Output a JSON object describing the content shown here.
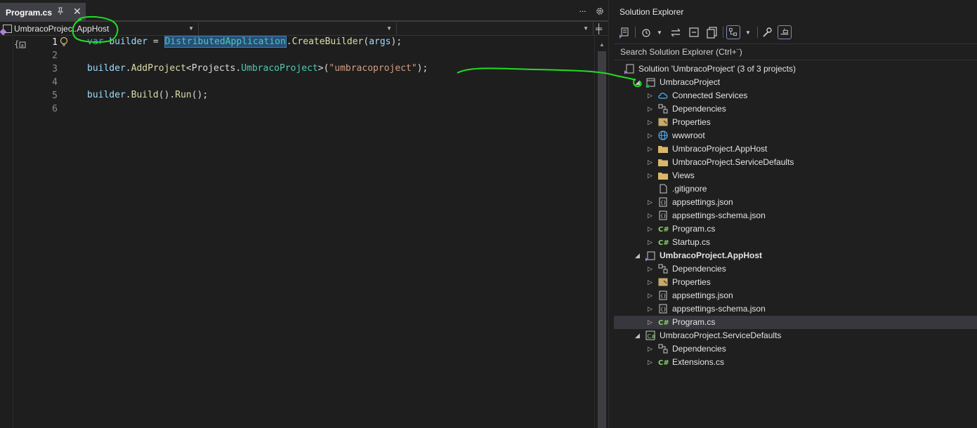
{
  "editor": {
    "tab": {
      "label": "Program.cs",
      "pin_icon": "pin-icon",
      "close_icon": "close-icon"
    },
    "tab_overflow": "···",
    "nav": {
      "project": "UmbracoProject.AppHost",
      "type": "",
      "member": ""
    },
    "lines": [
      "1",
      "2",
      "3",
      "4",
      "5",
      "6"
    ],
    "code": {
      "l1": {
        "kw": "var",
        "id": "builder",
        "eq": " = ",
        "cls": "DistributedApplication",
        "dot": ".",
        "method": "CreateBuilder",
        "open": "(",
        "arg": "args",
        "close": ");"
      },
      "l3": {
        "id": "builder",
        "dot": ".",
        "method": "AddProject",
        "lt": "<",
        "ns": "Projects",
        "dot2": ".",
        "type": "UmbracoProject",
        "gt": ">(",
        "str": "\"umbracoproject\"",
        "close": ");"
      },
      "l5": {
        "id": "builder",
        "dot": ".",
        "m1": "Build",
        "p1": "().",
        "m2": "Run",
        "p2": "();"
      }
    }
  },
  "solution_explorer": {
    "title": "Solution Explorer",
    "search_placeholder": "Search Solution Explorer (Ctrl+¨)",
    "tree": [
      {
        "label": "Solution 'UmbracoProject' (3 of 3 projects)",
        "icon": "solution-icon",
        "expander": ""
      },
      {
        "label": "UmbracoProject",
        "icon": "web-project-icon",
        "expander": "expanded"
      },
      {
        "label": "Connected Services",
        "icon": "cloud-icon",
        "expander": "collapsed"
      },
      {
        "label": "Dependencies",
        "icon": "dependencies-icon",
        "expander": "collapsed"
      },
      {
        "label": "Properties",
        "icon": "properties-icon",
        "expander": "collapsed"
      },
      {
        "label": "wwwroot",
        "icon": "globe-icon",
        "expander": "collapsed"
      },
      {
        "label": "UmbracoProject.AppHost",
        "icon": "folder-icon",
        "expander": "collapsed"
      },
      {
        "label": "UmbracoProject.ServiceDefaults",
        "icon": "folder-icon",
        "expander": "collapsed"
      },
      {
        "label": "Views",
        "icon": "folder-icon",
        "expander": "collapsed"
      },
      {
        "label": ".gitignore",
        "icon": "file-icon",
        "expander": ""
      },
      {
        "label": "appsettings.json",
        "icon": "json-icon",
        "expander": "collapsed"
      },
      {
        "label": "appsettings-schema.json",
        "icon": "json-icon",
        "expander": "collapsed"
      },
      {
        "label": "Program.cs",
        "icon": "csharp-file-icon",
        "expander": "collapsed"
      },
      {
        "label": "Startup.cs",
        "icon": "csharp-file-icon",
        "expander": "collapsed"
      },
      {
        "label": "UmbracoProject.AppHost",
        "icon": "apphost-project-icon",
        "expander": "expanded",
        "bold": true
      },
      {
        "label": "Dependencies",
        "icon": "dependencies-icon",
        "expander": "collapsed"
      },
      {
        "label": "Properties",
        "icon": "properties-icon",
        "expander": "collapsed"
      },
      {
        "label": "appsettings.json",
        "icon": "json-icon",
        "expander": "collapsed"
      },
      {
        "label": "appsettings-schema.json",
        "icon": "json-icon",
        "expander": "collapsed"
      },
      {
        "label": "Program.cs",
        "icon": "csharp-file-icon",
        "expander": "collapsed",
        "selected": true
      },
      {
        "label": "UmbracoProject.ServiceDefaults",
        "icon": "csharp-project-icon",
        "expander": "expanded"
      },
      {
        "label": "Dependencies",
        "icon": "dependencies-icon",
        "expander": "collapsed"
      },
      {
        "label": "Extensions.cs",
        "icon": "csharp-file-icon",
        "expander": "collapsed"
      }
    ]
  },
  "colors": {
    "keyword": "#569cd6",
    "identifier": "#9cdcfe",
    "method": "#dcdcaa",
    "type": "#4ec9b0",
    "string": "#d69d85",
    "annotation": "#22dd22",
    "selection": "#264f78"
  }
}
